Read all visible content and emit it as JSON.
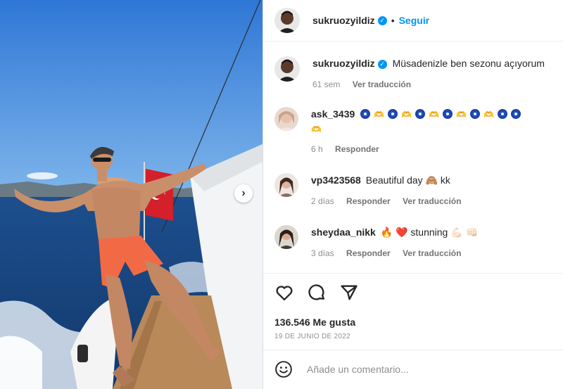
{
  "post": {
    "username": "sukruozyildiz",
    "separator": "•",
    "follow_label": "Seguir"
  },
  "caption": {
    "username": "sukruozyildiz",
    "text": "Müsadenizle ben sezonu açıyorum",
    "time": "61 sem",
    "translate_label": "Ver traducción"
  },
  "comments": [
    {
      "username": "ask_3439",
      "time": "6 h",
      "reply_label": "Responder",
      "emoji": [
        "nazar-amulet",
        "heart-hands",
        "nazar-amulet",
        "heart-hands",
        "nazar-amulet",
        "heart-hands",
        "nazar-amulet",
        "heart-hands",
        "nazar-amulet",
        "heart-hands",
        "nazar-amulet",
        "nazar-amulet",
        "heart-hands",
        "heart-hands"
      ]
    },
    {
      "username": "vp3423568",
      "text": "Beautiful day",
      "text2": "kk",
      "time": "2 días",
      "reply_label": "Responder",
      "translate_label": "Ver traducción"
    },
    {
      "username": "sheydaa_nikk",
      "text": "stunning",
      "time": "3 días",
      "reply_label": "Responder",
      "translate_label": "Ver traducción"
    }
  ],
  "likes": "136.546 Me gusta",
  "date": "19 DE JUNIO DE 2022",
  "add_comment": {
    "placeholder": "Añade un comentario..."
  },
  "icons": [
    "heart-icon",
    "comment-icon",
    "share-icon",
    "emoji-icon",
    "chevron-right-icon",
    "verified-badge-icon"
  ],
  "colors": {
    "accent": "#0095f6",
    "text": "#262626",
    "muted": "#8e8e8e"
  }
}
